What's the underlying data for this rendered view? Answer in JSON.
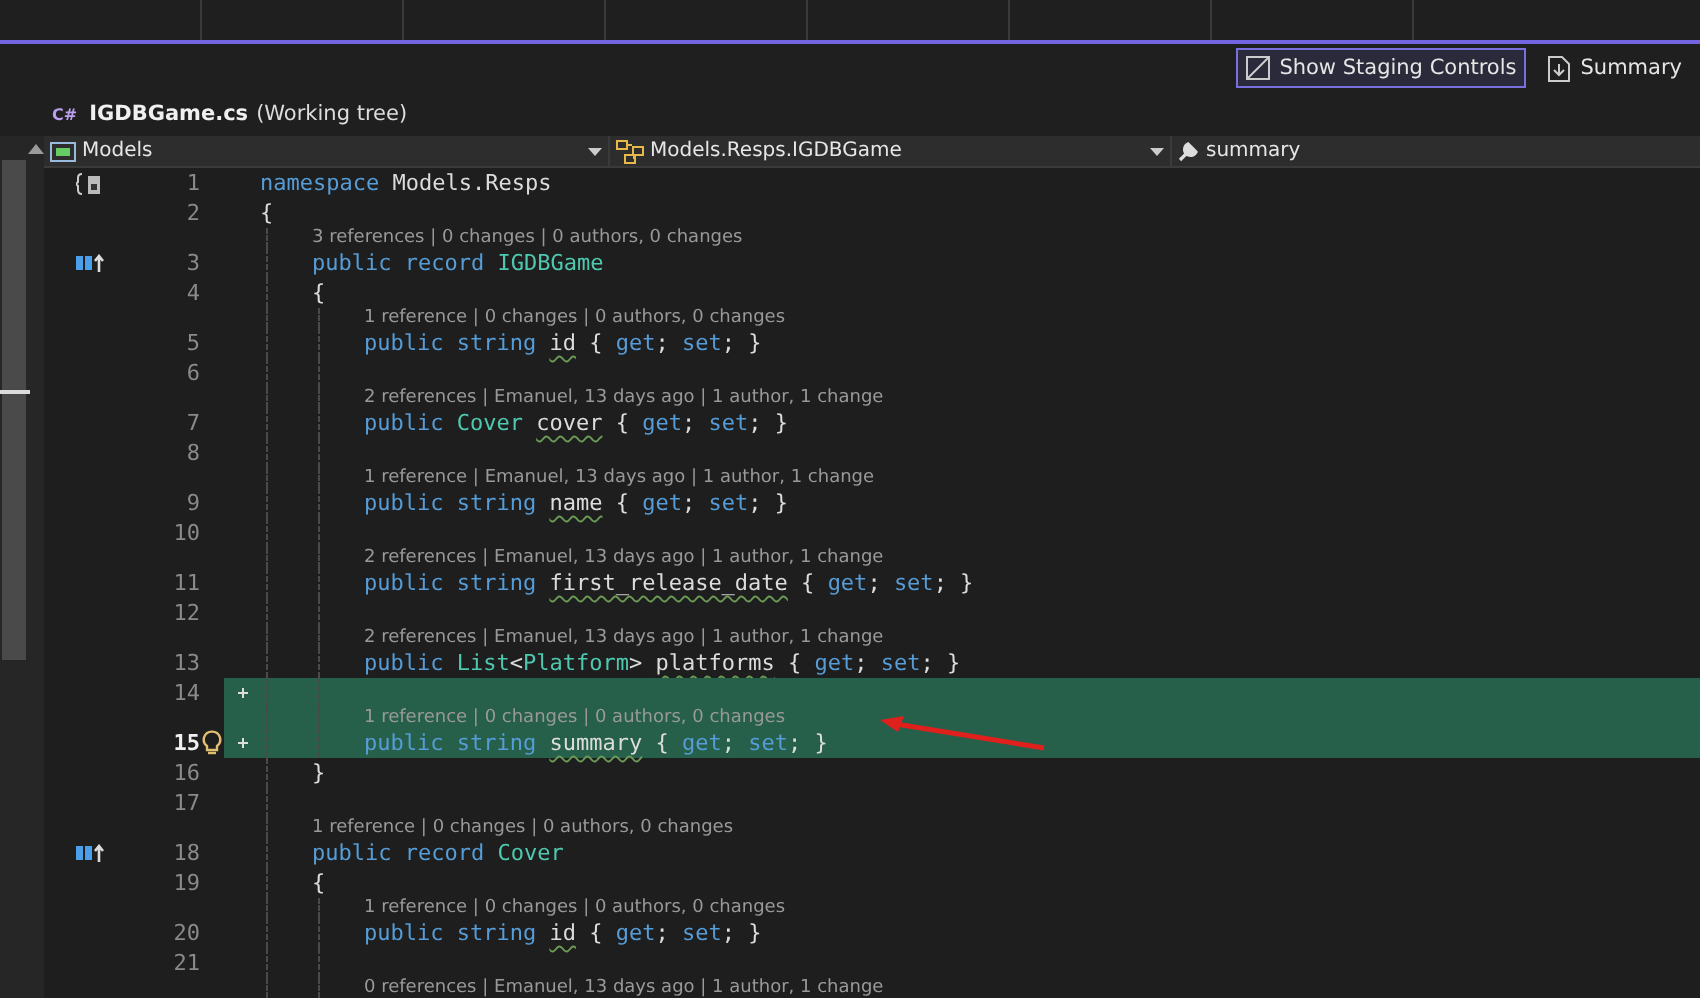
{
  "toolbar": {
    "buttons": [
      {
        "label": "Show Staging Controls",
        "kind": "toggle",
        "selected": true
      },
      {
        "label": "Summary",
        "kind": "doc",
        "selected": false
      }
    ]
  },
  "file_header": {
    "icon_label": "C#",
    "name": "IGDBGame.cs",
    "suffix": "(Working tree)"
  },
  "navigation_bar": [
    {
      "label": "Models",
      "kind": "project"
    },
    {
      "label": "Models.Resps.IGDBGame",
      "kind": "type"
    },
    {
      "label": "summary",
      "kind": "member"
    }
  ],
  "editor": {
    "lines": [
      {
        "number": "1",
        "gutter_icon": {
          "kind": "braces"
        },
        "tokens": [
          {
            "kind": "kw",
            "text": "namespace"
          },
          {
            "kind": "plain",
            "text": " Models.Resps"
          }
        ]
      },
      {
        "number": "2",
        "tokens": [
          {
            "kind": "plain",
            "text": "{"
          }
        ],
        "children": [
          {
            "number": "3",
            "gutter_icon": {
              "kind": "impl"
            },
            "lens": "3 references | 0 changes | 0 authors, 0 changes",
            "tokens": [
              {
                "kind": "kw",
                "text": "public record "
              },
              {
                "kind": "type",
                "text": "IGDBGame"
              }
            ]
          },
          {
            "number": "4",
            "tokens": [
              {
                "kind": "plain",
                "text": "{"
              }
            ],
            "children": [
              {
                "number": "5",
                "lens": "1 reference | 0 changes | 0 authors, 0 changes",
                "tokens": [
                  {
                    "kind": "kw",
                    "text": "public string "
                  },
                  {
                    "kind": "prop",
                    "text": "id"
                  },
                  {
                    "kind": "plain",
                    "text": " { "
                  },
                  {
                    "kind": "kw",
                    "text": "get"
                  },
                  {
                    "kind": "plain",
                    "text": "; "
                  },
                  {
                    "kind": "kw",
                    "text": "set"
                  },
                  {
                    "kind": "plain",
                    "text": "; }"
                  }
                ]
              },
              {
                "number": "6"
              },
              {
                "number": "7",
                "lens": "2 references | Emanuel, 13 days ago | 1 author, 1 change",
                "tokens": [
                  {
                    "kind": "kw",
                    "text": "public "
                  },
                  {
                    "kind": "type",
                    "text": "Cover "
                  },
                  {
                    "kind": "prop",
                    "text": "cover"
                  },
                  {
                    "kind": "plain",
                    "text": " { "
                  },
                  {
                    "kind": "kw",
                    "text": "get"
                  },
                  {
                    "kind": "plain",
                    "text": "; "
                  },
                  {
                    "kind": "kw",
                    "text": "set"
                  },
                  {
                    "kind": "plain",
                    "text": "; }"
                  }
                ]
              },
              {
                "number": "8"
              },
              {
                "number": "9",
                "lens": "1 reference | Emanuel, 13 days ago | 1 author, 1 change",
                "tokens": [
                  {
                    "kind": "kw",
                    "text": "public string "
                  },
                  {
                    "kind": "prop",
                    "text": "name"
                  },
                  {
                    "kind": "plain",
                    "text": " { "
                  },
                  {
                    "kind": "kw",
                    "text": "get"
                  },
                  {
                    "kind": "plain",
                    "text": "; "
                  },
                  {
                    "kind": "kw",
                    "text": "set"
                  },
                  {
                    "kind": "plain",
                    "text": "; }"
                  }
                ]
              },
              {
                "number": "10"
              },
              {
                "number": "11",
                "lens": "2 references | Emanuel, 13 days ago | 1 author, 1 change",
                "tokens": [
                  {
                    "kind": "kw",
                    "text": "public string "
                  },
                  {
                    "kind": "prop",
                    "text": "first_release_date"
                  },
                  {
                    "kind": "plain",
                    "text": " { "
                  },
                  {
                    "kind": "kw",
                    "text": "get"
                  },
                  {
                    "kind": "plain",
                    "text": "; "
                  },
                  {
                    "kind": "kw",
                    "text": "set"
                  },
                  {
                    "kind": "plain",
                    "text": "; }"
                  }
                ]
              },
              {
                "number": "12"
              },
              {
                "number": "13",
                "lens": "2 references | Emanuel, 13 days ago | 1 author, 1 change",
                "tokens": [
                  {
                    "kind": "kw",
                    "text": "public "
                  },
                  {
                    "kind": "type",
                    "text": "List"
                  },
                  {
                    "kind": "plain",
                    "text": "<"
                  },
                  {
                    "kind": "type",
                    "text": "Platform"
                  },
                  {
                    "kind": "plain",
                    "text": "> "
                  },
                  {
                    "kind": "prop",
                    "text": "platforms"
                  },
                  {
                    "kind": "plain",
                    "text": " { "
                  },
                  {
                    "kind": "kw",
                    "text": "get"
                  },
                  {
                    "kind": "plain",
                    "text": "; "
                  },
                  {
                    "kind": "kw",
                    "text": "set"
                  },
                  {
                    "kind": "plain",
                    "text": "; }"
                  }
                ]
              },
              {
                "number": "14",
                "added": true
              },
              {
                "number": "15",
                "added": true,
                "current": true,
                "bulb": true,
                "lens": "1 reference | 0 changes | 0 authors, 0 changes",
                "tokens": [
                  {
                    "kind": "kw",
                    "text": "public string "
                  },
                  {
                    "kind": "prop",
                    "text": "summary"
                  },
                  {
                    "kind": "plain",
                    "text": " { "
                  },
                  {
                    "kind": "kw",
                    "text": "get"
                  },
                  {
                    "kind": "plain",
                    "text": "; "
                  },
                  {
                    "kind": "kw",
                    "text": "set"
                  },
                  {
                    "kind": "plain",
                    "text": "; }"
                  }
                ]
              }
            ]
          },
          {
            "number": "16",
            "tokens": [
              {
                "kind": "plain",
                "text": "}"
              }
            ]
          },
          {
            "number": "17"
          },
          {
            "number": "18",
            "gutter_icon": {
              "kind": "impl"
            },
            "lens": "1 reference | 0 changes | 0 authors, 0 changes",
            "tokens": [
              {
                "kind": "kw",
                "text": "public record "
              },
              {
                "kind": "type",
                "text": "Cover"
              }
            ]
          },
          {
            "number": "19",
            "tokens": [
              {
                "kind": "plain",
                "text": "{"
              }
            ],
            "children": [
              {
                "number": "20",
                "lens": "1 reference | 0 changes | 0 authors, 0 changes",
                "tokens": [
                  {
                    "kind": "kw",
                    "text": "public string "
                  },
                  {
                    "kind": "prop",
                    "text": "id"
                  },
                  {
                    "kind": "plain",
                    "text": " { "
                  },
                  {
                    "kind": "kw",
                    "text": "get"
                  },
                  {
                    "kind": "plain",
                    "text": "; "
                  },
                  {
                    "kind": "kw",
                    "text": "set"
                  },
                  {
                    "kind": "plain",
                    "text": "; }"
                  }
                ]
              },
              {
                "number": "21"
              },
              {
                "lens": "0 references | Emanuel, 13 days ago | 1 author, 1 change"
              }
            ]
          }
        ]
      }
    ]
  }
}
